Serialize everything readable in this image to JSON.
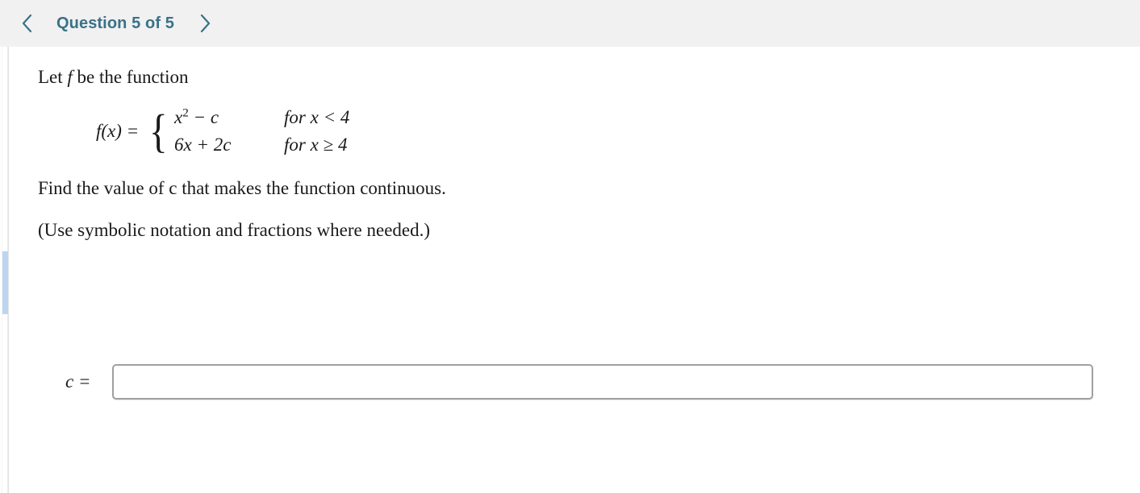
{
  "header": {
    "prev_icon": "chevron-left-icon",
    "title": "Question 5 of 5",
    "next_icon": "chevron-right-icon"
  },
  "colors": {
    "header_background": "#f1f1f1",
    "title_text": "#3a7189",
    "chevron": "#3a7189",
    "scroll_thumb": "#bcd6f2",
    "input_border": "#a0a0a0",
    "body_text": "#1a1a1a"
  },
  "problem": {
    "intro_prefix": "Let ",
    "intro_symbol": "f",
    "intro_suffix": " be the function",
    "equation": {
      "lhs_f": "f",
      "lhs_rest": "(x) =",
      "brace": "{",
      "cases": [
        {
          "expr_base": "x",
          "expr_exponent": "2",
          "expr_tail": " − c",
          "condition": "for x < 4"
        },
        {
          "expr_base": "",
          "expr_exponent": "",
          "expr_tail": "6x + 2c",
          "condition": "for x ≥ 4"
        }
      ]
    },
    "question_text": "Find the value of c that makes the function continuous.",
    "note_text": "(Use symbolic notation and fractions where needed.)"
  },
  "answer": {
    "label": "c =",
    "value": "",
    "placeholder": ""
  }
}
